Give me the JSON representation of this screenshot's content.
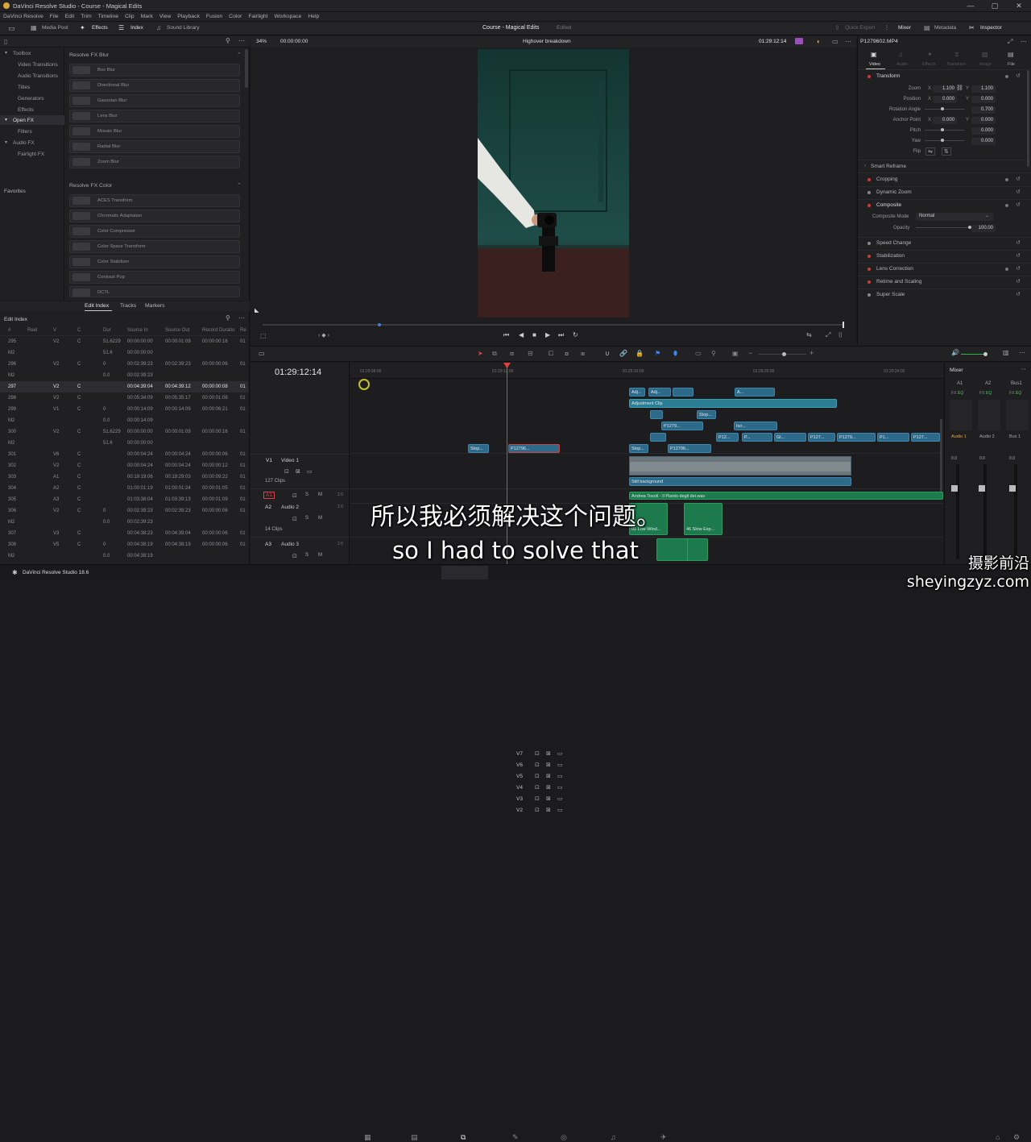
{
  "app": {
    "window_title": "DaVinci Resolve Studio - Course - Magical Edits",
    "window_controls": [
      "—",
      "▢",
      "✕"
    ],
    "menus": [
      "DaVinci Resolve",
      "File",
      "Edit",
      "Trim",
      "Timeline",
      "Clip",
      "Mark",
      "View",
      "Playback",
      "Fusion",
      "Color",
      "Fairlight",
      "Workspace",
      "Help"
    ],
    "footer_label": "DaVinci Resolve Studio 18.6"
  },
  "toolbar": {
    "media_pool": "Media Pool",
    "effects": "Effects",
    "index": "Index",
    "sound_library": "Sound Library",
    "project_name": "Course - Magical Edits",
    "edited_status": "Edited",
    "quick_export": "Quick Export",
    "mixer": "Mixer",
    "metadata": "Metadata",
    "inspector": "Inspector"
  },
  "effects_tree": {
    "items": [
      "Toolbox",
      "Video Transitions",
      "Audio Transitions",
      "Titles",
      "Generators",
      "Effects",
      "Open FX",
      "Filters",
      "Audio FX",
      "Fairlight FX"
    ],
    "favorites": "Favorites"
  },
  "fx_blur": {
    "header": "Resolve FX Blur",
    "items": [
      "Box Blur",
      "Directional Blur",
      "Gaussian Blur",
      "Lens Blur",
      "Mosaic Blur",
      "Radial Blur",
      "Zoom Blur"
    ]
  },
  "fx_color": {
    "header": "Resolve FX Color",
    "items": [
      "ACES Transform",
      "Chromatic Adaptation",
      "Color Compressor",
      "Color Space Transform",
      "Color Stabilizer",
      "Contrast Pop",
      "DCTL"
    ]
  },
  "edit_index": {
    "tabs": [
      "Edit Index",
      "Tracks",
      "Markers"
    ],
    "title": "Edit Index",
    "columns": [
      "#",
      "Reel",
      "V",
      "C",
      "Dur",
      "Source In",
      "Source Out",
      "Record Duratio",
      "Re"
    ],
    "rows": [
      [
        "295",
        "",
        "V2",
        "C",
        "51.6229",
        "00:00:00:00",
        "00:00:01:09",
        "00:00:00:16",
        "01"
      ],
      [
        "M2",
        "",
        "",
        "",
        "51.6",
        "00:00:00:00",
        "",
        "",
        ""
      ],
      [
        "296",
        "",
        "V2",
        "C",
        "0",
        "00:02:39:23",
        "00:02:39:23",
        "00:00:00:06",
        "01"
      ],
      [
        "M2",
        "",
        "",
        "",
        "0.0",
        "00:02:39:23",
        "",
        "",
        ""
      ],
      [
        "297",
        "",
        "V2",
        "C",
        "",
        "00:04:39:04",
        "00:04:39:12",
        "00:00:00:08",
        "01"
      ],
      [
        "298",
        "",
        "V2",
        "C",
        "",
        "00:05:34:09",
        "00:05:35:17",
        "00:00:01:08",
        "01"
      ],
      [
        "299",
        "",
        "V1",
        "C",
        "0",
        "00:00:14:09",
        "00:00:14:09",
        "00:00:06:21",
        "01"
      ],
      [
        "M2",
        "",
        "",
        "",
        "0.0",
        "00:00:14:09",
        "",
        "",
        ""
      ],
      [
        "300",
        "",
        "V2",
        "C",
        "51.6229",
        "00:00:00:00",
        "00:00:01:09",
        "00:00:00:16",
        "01"
      ],
      [
        "M2",
        "",
        "",
        "",
        "51.6",
        "00:00:00:00",
        "",
        "",
        ""
      ],
      [
        "301",
        "",
        "V6",
        "C",
        "",
        "00:00:04:24",
        "00:00:04:24",
        "00:00:00:06",
        "01"
      ],
      [
        "302",
        "",
        "V2",
        "C",
        "",
        "00:00:04:24",
        "00:00:04:24",
        "00:00:00:12",
        "01"
      ],
      [
        "303",
        "",
        "A1",
        "C",
        "",
        "00:19:19:06",
        "00:19:29:03",
        "00:00:09:22",
        "01"
      ],
      [
        "304",
        "",
        "A2",
        "C",
        "",
        "01:00:01:19",
        "01:00:01:24",
        "00:00:01:05",
        "01"
      ],
      [
        "305",
        "",
        "A3",
        "C",
        "",
        "01:03:38:04",
        "01:03:39:13",
        "00:00:01:09",
        "01"
      ],
      [
        "306",
        "",
        "V2",
        "C",
        "0",
        "00:02:39:23",
        "00:02:39:23",
        "00:00:00:06",
        "01"
      ],
      [
        "M2",
        "",
        "",
        "",
        "0.0",
        "00:02:39:23",
        "",
        "",
        ""
      ],
      [
        "307",
        "",
        "V3",
        "C",
        "",
        "00:04:38:23",
        "00:04:39:04",
        "00:00:00:06",
        "01"
      ],
      [
        "308",
        "",
        "V5",
        "C",
        "0",
        "00:04:38:19",
        "00:04:38:19",
        "00:00:00:06",
        "01"
      ],
      [
        "M2",
        "",
        "",
        "",
        "0.0",
        "00:04:38:19",
        "",
        "",
        ""
      ]
    ]
  },
  "viewer": {
    "zoom": "34%",
    "timecode_left": "00:00:00:00",
    "clip_name": "Highover breakdown",
    "timecode_right": "01:29:12:14"
  },
  "inspector": {
    "clip_name": "P1279602.MP4",
    "tabs": [
      "Video",
      "Audio",
      "Effects",
      "Transition",
      "Image",
      "File"
    ],
    "transform": "Transform",
    "zoom_label": "Zoom",
    "zoom_x": "1.100",
    "zoom_y": "1.100",
    "position_label": "Position",
    "position_x": "0.000",
    "position_y": "0.000",
    "rotation_label": "Rotation Angle",
    "rotation": "0.700",
    "anchor_label": "Anchor Point",
    "anchor_x": "0.000",
    "anchor_y": "0.000",
    "pitch_label": "Pitch",
    "pitch": "0.000",
    "yaw_label": "Yaw",
    "yaw": "0.000",
    "flip_label": "Flip",
    "x_label": "X",
    "y_label": "Y",
    "smart_reframe": "Smart Reframe",
    "cropping": "Cropping",
    "dynamic_zoom": "Dynamic Zoom",
    "composite": "Composite",
    "composite_mode_label": "Composite Mode",
    "composite_mode": "Normal",
    "opacity_label": "Opacity",
    "opacity": "100.00",
    "speed_change": "Speed Change",
    "stabilization": "Stabilization",
    "lens_correction": "Lens Correction",
    "retime_scaling": "Retime and Scaling",
    "super_scale": "Super Scale"
  },
  "timeline": {
    "timecode": "01:29:12:14",
    "ruler": [
      "01:29:08:00",
      "01:29:12:00",
      "01:29:16:00",
      "01:29:20:00",
      "01:29:24:00"
    ],
    "tracks": [
      "V7",
      "V6",
      "V5",
      "V4",
      "V3",
      "V2"
    ],
    "v1_label": "V1",
    "v1_name": "Video 1",
    "clips_count": "127 Clips",
    "a1_label": "A1",
    "a2_label": "A2",
    "a2_name": "Audio 2",
    "a2_clips": "14 Clips",
    "a3_label": "A3",
    "a3_name": "Audio 3",
    "audio_level": "2.0",
    "clip_labels": {
      "adj1": "Adj...",
      "adj2": "Adj...",
      "a": "A...",
      "adjustment": "Adjustment Clip",
      "stop1": "Stop...",
      "p1279a": "P1279...",
      "iso": "Iso...",
      "p12": "P12...",
      "p": "P...",
      "gl": "Gl...",
      "p127a": "P127...",
      "p1279b": "P1279...",
      "p1": "P1...",
      "p127b": "P127...",
      "stop2": "Stop...",
      "p12796": "P12796...",
      "stop3": "Stop...",
      "p1279c": "P12796...",
      "still": "Still background",
      "audio_long": "Andrea Tosoli - Il Pianto degli dei.wav",
      "low_wind": "01 Low Wind...",
      "slow_exp": "46 Slow Exp..."
    }
  },
  "mixer": {
    "title": "Mixer",
    "channels": [
      "A1",
      "A2",
      "Bus1"
    ],
    "names": [
      "Audio 1",
      "Audio 2",
      "Bus 1"
    ],
    "eq": "EQ",
    "fx": "FX",
    "zero": "0.0"
  },
  "subtitle": {
    "zh": "所以我必须解决这个问题。",
    "en": "so I had to solve that"
  },
  "watermark": "摄影前沿 sheyingzyz.com",
  "colors": {
    "accent_red": "#e04040",
    "clip_blue": "#2d6a8a",
    "clip_green": "#1d7a4c"
  }
}
